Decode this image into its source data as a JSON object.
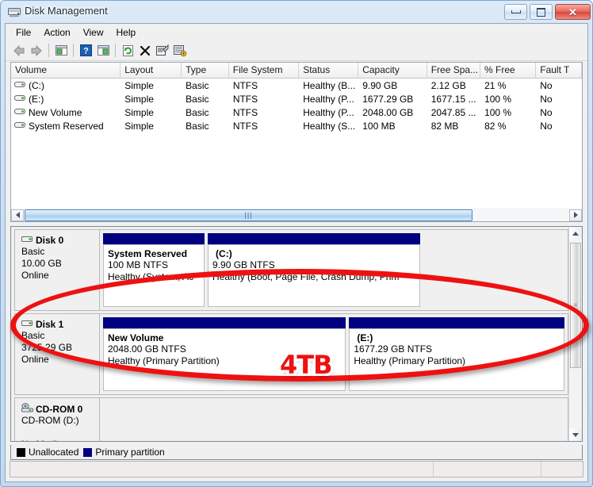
{
  "window": {
    "title": "Disk Management",
    "icon": "disk-management-icon",
    "controls": {
      "minimize": "Minimize",
      "maximize": "Maximize",
      "close": "Close"
    }
  },
  "menubar": {
    "items": [
      {
        "label": "File"
      },
      {
        "label": "Action"
      },
      {
        "label": "View"
      },
      {
        "label": "Help"
      }
    ]
  },
  "toolbar": {
    "buttons": [
      {
        "name": "back-icon",
        "tooltip": "Back"
      },
      {
        "name": "forward-icon",
        "tooltip": "Forward"
      },
      {
        "name": "up-one-level-icon",
        "tooltip": "Up One Level"
      },
      {
        "name": "help-icon",
        "tooltip": "Help"
      },
      {
        "name": "show-hide-console-tree-icon",
        "tooltip": "Show/Hide Console Tree"
      },
      {
        "name": "refresh-icon",
        "tooltip": "Refresh"
      },
      {
        "name": "delete-icon",
        "tooltip": "Delete"
      },
      {
        "name": "properties-icon",
        "tooltip": "Properties"
      },
      {
        "name": "rescan-disks-icon",
        "tooltip": "Rescan Disks"
      }
    ]
  },
  "volume_list": {
    "columns": [
      "Volume",
      "Layout",
      "Type",
      "File System",
      "Status",
      "Capacity",
      "Free Spa...",
      "% Free",
      "Fault T"
    ],
    "rows": [
      {
        "volume": "(C:)",
        "layout": "Simple",
        "type": "Basic",
        "file_system": "NTFS",
        "status": "Healthy (B...",
        "capacity": "9.90 GB",
        "free_space": "2.12 GB",
        "percent_free": "21 %",
        "fault_tolerance": "No"
      },
      {
        "volume": "(E:)",
        "layout": "Simple",
        "type": "Basic",
        "file_system": "NTFS",
        "status": "Healthy (P...",
        "capacity": "1677.29 GB",
        "free_space": "1677.15 ...",
        "percent_free": "100 %",
        "fault_tolerance": "No"
      },
      {
        "volume": "New Volume",
        "layout": "Simple",
        "type": "Basic",
        "file_system": "NTFS",
        "status": "Healthy (P...",
        "capacity": "2048.00 GB",
        "free_space": "2047.85 ...",
        "percent_free": "100 %",
        "fault_tolerance": "No"
      },
      {
        "volume": "System Reserved",
        "layout": "Simple",
        "type": "Basic",
        "file_system": "NTFS",
        "status": "Healthy (S...",
        "capacity": "100 MB",
        "free_space": "82 MB",
        "percent_free": "82 %",
        "fault_tolerance": "No"
      }
    ]
  },
  "disk_view": {
    "disks": [
      {
        "name": "Disk 0",
        "kind": "Basic",
        "size": "10.00 GB",
        "state": "Online",
        "icon": "hard-disk-icon",
        "partitions": [
          {
            "name": "System Reserved",
            "size_fs": "100 MB NTFS",
            "health": "Healthy (System, Ac",
            "width_pct": 22
          },
          {
            "name": "(C:)",
            "size_fs": "9.90 GB NTFS",
            "health": "Healthy (Boot, Page File, Crash Dump, Prim",
            "width_pct": 46
          }
        ]
      },
      {
        "name": "Disk 1",
        "kind": "Basic",
        "size": "3725.29 GB",
        "state": "Online",
        "icon": "hard-disk-icon",
        "partitions": [
          {
            "name": "New Volume",
            "size_fs": "2048.00 GB NTFS",
            "health": "Healthy (Primary Partition)",
            "width_pct": 53
          },
          {
            "name": "(E:)",
            "size_fs": "1677.29 GB NTFS",
            "health": "Healthy (Primary Partition)",
            "width_pct": 47
          }
        ]
      },
      {
        "name": "CD-ROM 0",
        "kind": "CD-ROM (D:)",
        "size": "",
        "state": "No Media",
        "icon": "cd-rom-icon",
        "partitions": []
      }
    ]
  },
  "legend": {
    "items": [
      {
        "label": "Unallocated",
        "color": "#000000"
      },
      {
        "label": "Primary partition",
        "color": "#000080"
      }
    ]
  },
  "annotation": {
    "label": "4TB",
    "color": "#ee1111",
    "shape": "ellipse-highlight"
  },
  "statusbar": {
    "segments": [
      "",
      "",
      ""
    ]
  },
  "colors": {
    "partition_header": "#000080",
    "frame": "#7ba7d4",
    "annotation_red": "#ee1111"
  }
}
